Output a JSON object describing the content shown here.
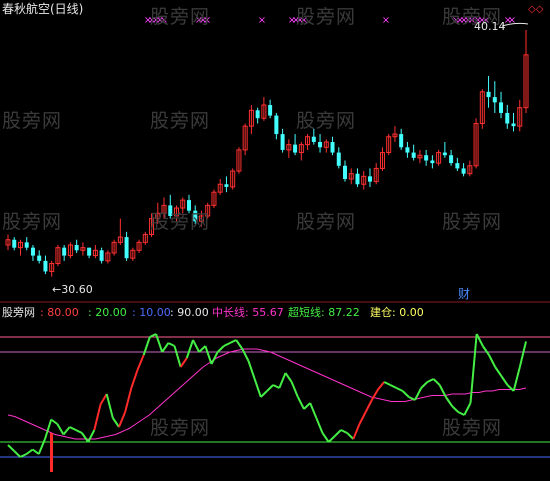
{
  "header": {
    "title": "春秋航空(日线)"
  },
  "price_panel": {
    "high_label": "40.14",
    "low_label": "←30.60",
    "finance_marker": "财",
    "diamond_icon": "diamond-icon"
  },
  "indicator_header": {
    "name": "股旁网",
    "items": [
      {
        "text": ": 80.00",
        "color": "#ff4040"
      },
      {
        "text": ": 20.00",
        "color": "#44ee44"
      },
      {
        "text": ": 10.00",
        "color": "#4a6cff"
      },
      {
        "text": ": 90.00",
        "color": "#e8e8e8"
      },
      {
        "text": "中长线: 55.67",
        "color": "#ff33cc"
      },
      {
        "text": "超短线: 87.22",
        "color": "#44ee44"
      },
      {
        "text": "建仓: 0.00",
        "color": "#ffff66"
      }
    ]
  },
  "watermarks": [
    "股旁网",
    "股旁网",
    "股旁网",
    "股旁网",
    "股旁网",
    "股旁网",
    "股旁网",
    "股旁网",
    "股旁网",
    "股旁网",
    "股旁网",
    "股旁网"
  ],
  "chart_data": {
    "type": "candlestick",
    "title": "春秋航空(日线)",
    "price_high_label": 40.14,
    "price_low_label": 30.6,
    "candles": [
      [
        32.0,
        32.4,
        31.8,
        32.2
      ],
      [
        32.2,
        32.3,
        31.8,
        31.9
      ],
      [
        31.9,
        32.2,
        31.6,
        32.1
      ],
      [
        32.1,
        32.3,
        31.8,
        31.9
      ],
      [
        31.9,
        32.0,
        31.4,
        31.6
      ],
      [
        31.6,
        31.8,
        31.3,
        31.4
      ],
      [
        31.4,
        31.6,
        30.9,
        31.0
      ],
      [
        31.0,
        31.4,
        30.8,
        31.3
      ],
      [
        31.3,
        32.0,
        31.2,
        31.9
      ],
      [
        31.9,
        32.0,
        31.4,
        31.6
      ],
      [
        31.6,
        32.1,
        31.5,
        32.0
      ],
      [
        32.0,
        32.2,
        31.7,
        31.8
      ],
      [
        31.8,
        32.1,
        31.6,
        31.9
      ],
      [
        31.9,
        31.9,
        31.5,
        31.6
      ],
      [
        31.6,
        32.0,
        31.5,
        31.8
      ],
      [
        31.8,
        31.9,
        31.3,
        31.4
      ],
      [
        31.4,
        31.8,
        31.3,
        31.7
      ],
      [
        31.7,
        32.2,
        31.6,
        32.1
      ],
      [
        32.1,
        33.0,
        32.0,
        32.3
      ],
      [
        32.3,
        32.5,
        31.4,
        31.5
      ],
      [
        31.5,
        31.9,
        31.4,
        31.8
      ],
      [
        31.8,
        32.2,
        31.7,
        32.1
      ],
      [
        32.1,
        32.5,
        32.0,
        32.4
      ],
      [
        32.4,
        33.2,
        32.3,
        33.0
      ],
      [
        33.0,
        33.6,
        32.8,
        33.2
      ],
      [
        33.2,
        33.8,
        33.0,
        33.5
      ],
      [
        33.5,
        33.9,
        33.0,
        33.1
      ],
      [
        33.1,
        33.5,
        32.9,
        33.4
      ],
      [
        33.4,
        33.8,
        33.2,
        33.7
      ],
      [
        33.7,
        33.9,
        33.2,
        33.3
      ],
      [
        33.3,
        33.5,
        32.8,
        32.9
      ],
      [
        32.9,
        33.3,
        32.7,
        33.1
      ],
      [
        33.1,
        33.6,
        33.0,
        33.5
      ],
      [
        33.5,
        34.1,
        33.4,
        34.0
      ],
      [
        34.0,
        34.5,
        33.9,
        34.3
      ],
      [
        34.3,
        34.6,
        34.0,
        34.2
      ],
      [
        34.2,
        34.9,
        34.1,
        34.8
      ],
      [
        34.8,
        35.7,
        34.7,
        35.6
      ],
      [
        35.6,
        36.6,
        35.4,
        36.5
      ],
      [
        36.5,
        37.3,
        36.2,
        37.1
      ],
      [
        37.1,
        37.2,
        36.6,
        36.8
      ],
      [
        36.8,
        37.6,
        36.7,
        37.3
      ],
      [
        37.3,
        37.5,
        36.8,
        36.9
      ],
      [
        36.9,
        37.0,
        36.0,
        36.2
      ],
      [
        36.2,
        36.4,
        35.5,
        35.6
      ],
      [
        35.6,
        36.0,
        35.3,
        35.8
      ],
      [
        35.8,
        36.2,
        35.4,
        35.5
      ],
      [
        35.5,
        35.9,
        35.2,
        35.8
      ],
      [
        35.8,
        36.2,
        35.6,
        36.1
      ],
      [
        36.1,
        36.4,
        35.8,
        35.9
      ],
      [
        35.9,
        36.2,
        35.5,
        35.7
      ],
      [
        35.7,
        36.0,
        35.5,
        35.9
      ],
      [
        35.9,
        36.1,
        35.4,
        35.5
      ],
      [
        35.5,
        35.7,
        34.9,
        35.0
      ],
      [
        35.0,
        35.2,
        34.4,
        34.5
      ],
      [
        34.5,
        34.9,
        34.3,
        34.7
      ],
      [
        34.7,
        34.9,
        34.2,
        34.3
      ],
      [
        34.3,
        34.8,
        34.1,
        34.6
      ],
      [
        34.6,
        34.9,
        34.2,
        34.4
      ],
      [
        34.4,
        35.1,
        34.3,
        34.9
      ],
      [
        34.9,
        35.7,
        34.8,
        35.5
      ],
      [
        35.5,
        36.2,
        35.4,
        36.1
      ],
      [
        36.1,
        36.5,
        35.9,
        36.2
      ],
      [
        36.2,
        36.4,
        35.6,
        35.7
      ],
      [
        35.7,
        35.9,
        35.3,
        35.5
      ],
      [
        35.5,
        35.8,
        35.2,
        35.3
      ],
      [
        35.3,
        35.6,
        35.1,
        35.4
      ],
      [
        35.4,
        35.6,
        35.0,
        35.2
      ],
      [
        35.2,
        35.4,
        34.9,
        35.1
      ],
      [
        35.1,
        35.6,
        35.0,
        35.5
      ],
      [
        35.5,
        35.9,
        35.3,
        35.4
      ],
      [
        35.4,
        35.6,
        35.0,
        35.1
      ],
      [
        35.1,
        35.3,
        34.8,
        34.9
      ],
      [
        34.9,
        35.1,
        34.6,
        34.7
      ],
      [
        34.7,
        35.2,
        34.6,
        35.0
      ],
      [
        35.0,
        36.8,
        34.9,
        36.6
      ],
      [
        36.6,
        37.9,
        36.4,
        37.8
      ],
      [
        37.8,
        38.4,
        37.2,
        37.6
      ],
      [
        37.6,
        38.2,
        37.0,
        37.4
      ],
      [
        37.4,
        37.8,
        36.8,
        37.0
      ],
      [
        37.0,
        37.3,
        36.4,
        36.6
      ],
      [
        36.6,
        37.0,
        36.3,
        36.5
      ],
      [
        36.5,
        37.5,
        36.3,
        37.2
      ],
      [
        37.2,
        40.14,
        37.0,
        39.2
      ]
    ],
    "indicator": {
      "levels": [
        80,
        20,
        10,
        90
      ],
      "series": [
        {
          "name": "中长线",
          "last": 55.67,
          "color": "#ff33cc",
          "values": [
            38,
            37,
            35,
            33,
            31,
            29,
            27,
            25,
            24,
            23,
            22,
            22,
            22,
            22,
            23,
            24,
            25,
            27,
            29,
            32,
            35,
            38,
            42,
            46,
            50,
            54,
            58,
            62,
            66,
            70,
            73,
            76,
            78,
            80,
            81,
            82,
            82,
            82,
            81,
            80,
            78,
            76,
            74,
            72,
            70,
            68,
            66,
            64,
            62,
            60,
            58,
            56,
            54,
            52,
            50,
            49,
            48,
            47,
            47,
            47,
            48,
            49,
            50,
            51,
            51,
            51,
            52,
            52,
            52,
            53,
            53,
            54,
            54,
            55,
            55,
            55,
            55,
            56
          ]
        },
        {
          "name": "超短线",
          "last": 87.22,
          "color": "#44ee44",
          "values": [
            18,
            14,
            10,
            12,
            15,
            12,
            22,
            35,
            32,
            25,
            30,
            28,
            26,
            20,
            28,
            45,
            52,
            36,
            30,
            40,
            56,
            68,
            78,
            90,
            92,
            80,
            86,
            84,
            70,
            76,
            88,
            80,
            84,
            72,
            80,
            84,
            86,
            88,
            82,
            74,
            62,
            50,
            54,
            58,
            56,
            66,
            60,
            50,
            42,
            46,
            36,
            26,
            20,
            24,
            28,
            26,
            22,
            32,
            40,
            48,
            55,
            60,
            58,
            56,
            54,
            50,
            48,
            56,
            60,
            62,
            58,
            50,
            44,
            40,
            38,
            46,
            92,
            84,
            78,
            70,
            64,
            58,
            54,
            70,
            87
          ]
        },
        {
          "name": "建仓",
          "last": 0.0,
          "color": "#ffff66",
          "values": []
        }
      ]
    }
  }
}
